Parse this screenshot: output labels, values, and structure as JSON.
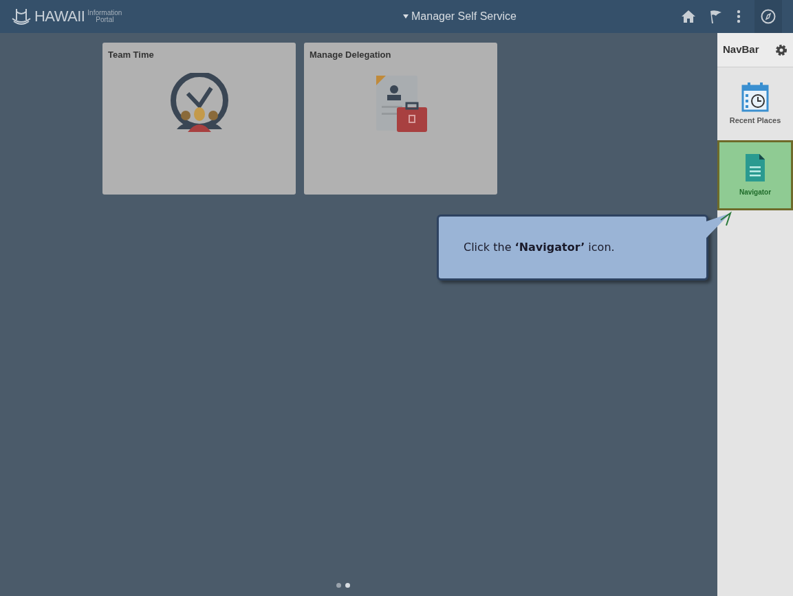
{
  "header": {
    "logo_text": "HAWAII",
    "logo_subtext_1": "Information",
    "logo_subtext_2": "Portal",
    "title": "Manager Self Service"
  },
  "tiles": [
    {
      "title": "Team Time",
      "kind": "team-time"
    },
    {
      "title": "Manage Delegation",
      "kind": "delegation"
    }
  ],
  "navbar": {
    "title": "NavBar",
    "items": [
      {
        "label": "Recent Places",
        "kind": "recent",
        "selected": false
      },
      {
        "label": "Navigator",
        "kind": "navigator",
        "selected": true
      }
    ]
  },
  "callout": {
    "text": "Click the **‘Navigator’** icon."
  },
  "pager": [
    {
      "selected": false
    },
    {
      "selected": true
    }
  ]
}
